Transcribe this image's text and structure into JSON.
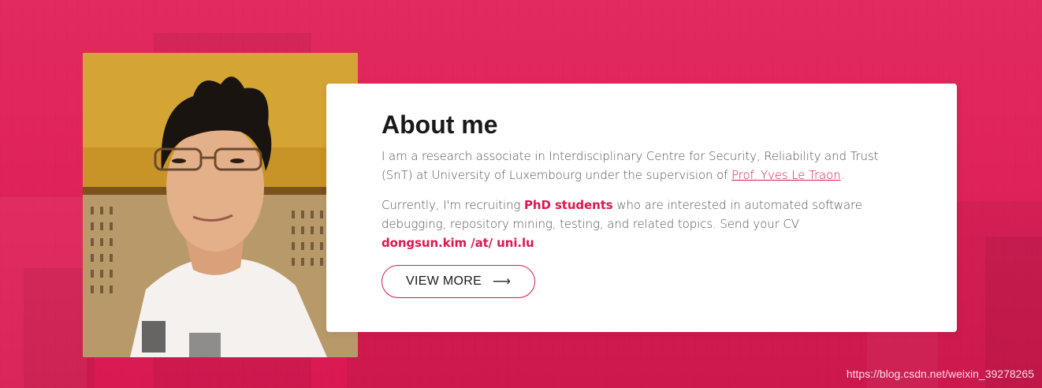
{
  "about": {
    "title": "About me",
    "para1_text": "I am a research associate in Interdisciplinary Centre for Security, Reliability and Trust (SnT) at University of Luxembourg under the supervision of ",
    "para1_link": "Prof. Yves Le Traon",
    "para1_end": ".",
    "para2_start": "Currently, I'm recruiting ",
    "para2_strong": "PhD students",
    "para2_mid": " who are interested in automated software debugging, repository mining, testing, and related topics. Send your CV ",
    "para2_email": "dongsun.kim /at/ uni.lu",
    "para2_end": ".",
    "button_label": "VIEW MORE",
    "button_icon": "arrow-right-icon"
  },
  "watermark": "https://blog.csdn.net/weixin_39278265",
  "colors": {
    "accent": "#d9194f",
    "background": "#e02659",
    "card": "#ffffff",
    "title": "#1a1a1a",
    "body_text": "#555555"
  }
}
